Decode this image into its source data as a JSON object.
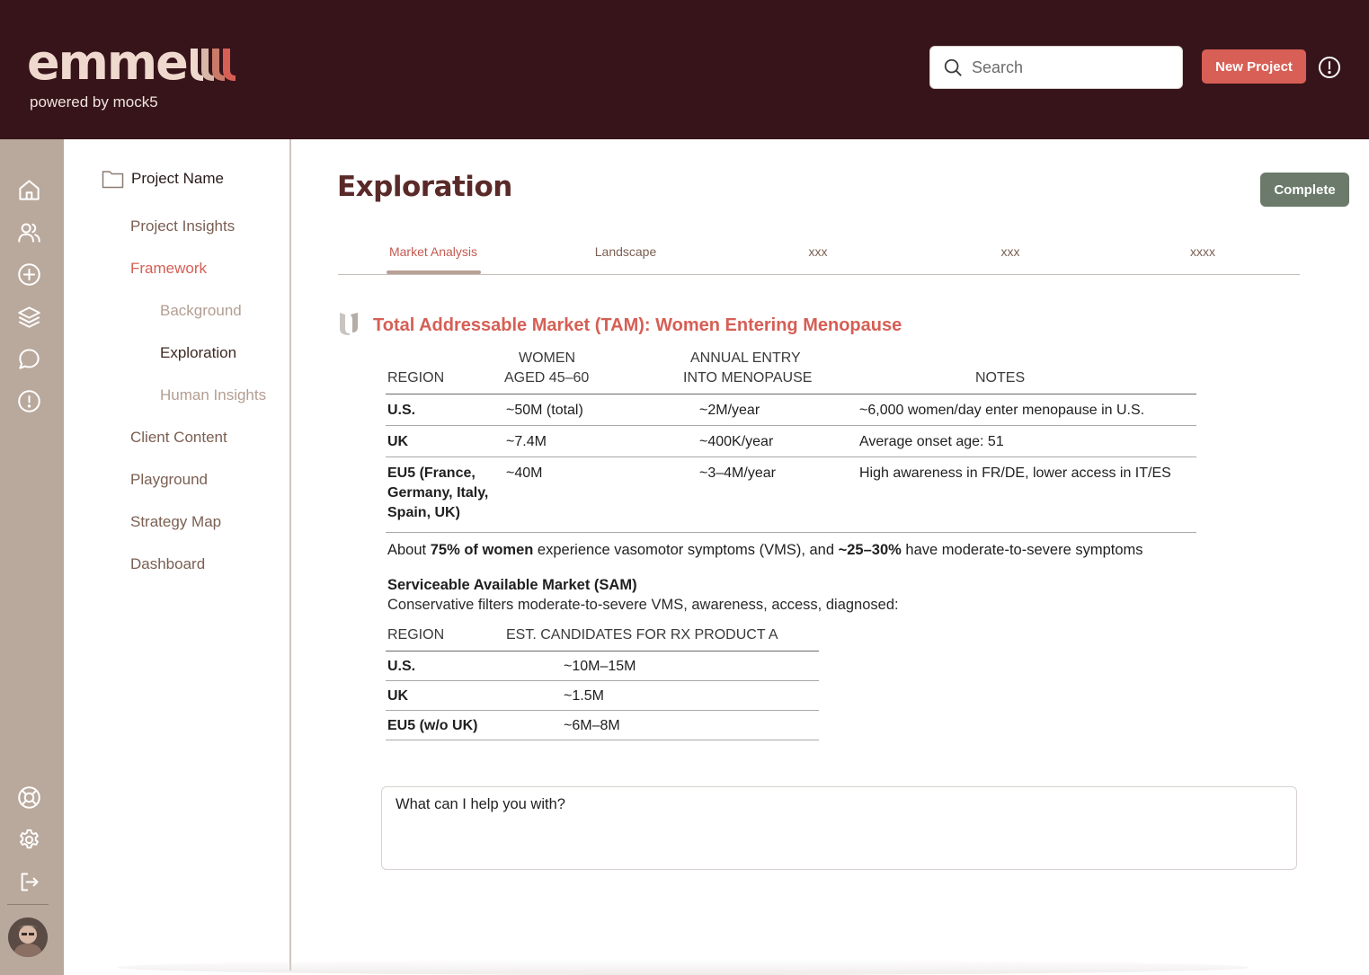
{
  "header": {
    "logo_text": "emme",
    "tagline": "powered by mock5",
    "search_placeholder": "Search",
    "new_project_label": "New Project"
  },
  "rail": {
    "icons": [
      "home-icon",
      "users-icon",
      "plus-circle-icon",
      "layers-icon",
      "chat-icon",
      "alert-icon",
      "help-lifebuoy-icon",
      "settings-icon",
      "logout-icon"
    ]
  },
  "sidebar": {
    "project_name": "Project Name",
    "items": [
      {
        "label": "Project Insights"
      },
      {
        "label": "Framework"
      },
      {
        "label": "Background"
      },
      {
        "label": "Exploration"
      },
      {
        "label": "Human Insights"
      },
      {
        "label": "Client Content"
      },
      {
        "label": "Playground"
      },
      {
        "label": "Strategy Map"
      },
      {
        "label": "Dashboard"
      }
    ]
  },
  "main": {
    "title": "Exploration",
    "complete_label": "Complete",
    "tabs": [
      {
        "label": "Market Analysis"
      },
      {
        "label": "Landscape"
      },
      {
        "label": "xxx"
      },
      {
        "label": "xxx"
      },
      {
        "label": "xxxx"
      }
    ],
    "section_title": "Total Addressable Market (TAM): Women Entering Menopause",
    "tam_table": {
      "headers": [
        {
          "line1": "",
          "line2": "REGION"
        },
        {
          "line1": "WOMEN",
          "line2": "AGED 45–60"
        },
        {
          "line1": "ANNUAL ENTRY",
          "line2": "INTO MENOPAUSE"
        },
        {
          "line1": "",
          "line2": "NOTES"
        }
      ],
      "rows": [
        {
          "region": "U.S.",
          "women": "~50M (total)",
          "entry": "~2M/year",
          "notes": "~6,000 women/day enter menopause in U.S."
        },
        {
          "region": "UK",
          "women": "~7.4M",
          "entry": "~400K/year",
          "notes": "Average onset age: 51"
        },
        {
          "region": "EU5 (France, Germany, Italy, Spain, UK)",
          "women": "~40M",
          "entry": "~3–4M/year",
          "notes": "High awareness in FR/DE, lower access in IT/ES"
        }
      ]
    },
    "paragraph": {
      "p1": "About ",
      "b1": "75% of women",
      "p2": " experience vasomotor symptoms (VMS), and ",
      "b2": "~25–30%",
      "p3": " have moderate-to-severe symptoms"
    },
    "sam": {
      "title": "Serviceable Available Market (SAM)",
      "subtitle": "Conservative filters moderate-to-severe VMS, awareness, access, diagnosed:",
      "headers": [
        "REGION",
        "EST. CANDIDATES FOR RX PRODUCT A"
      ],
      "rows": [
        {
          "region": "U.S.",
          "value": "~10M–15M"
        },
        {
          "region": "UK",
          "value": "~1.5M"
        },
        {
          "region": "EU5 (w/o UK)",
          "value": "~6M–8M"
        }
      ]
    },
    "prompt_placeholder": "What can I help you with?"
  },
  "colors": {
    "header_bg": "#36141a",
    "accent": "#d85f55",
    "complete_bg": "#6b7a6a",
    "rail_bg": "#b9a89c"
  }
}
